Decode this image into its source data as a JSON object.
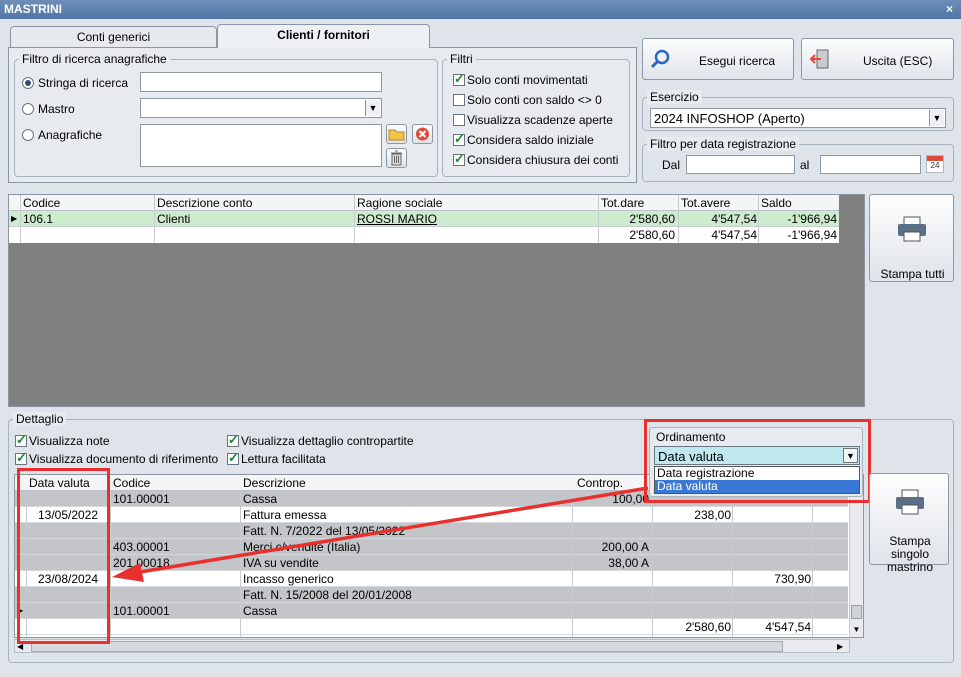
{
  "window": {
    "title": "MASTRINI",
    "close_glyph": "×"
  },
  "tabs": [
    {
      "label": "Conti generici"
    },
    {
      "label": "Clienti / fornitori"
    }
  ],
  "search_filter": {
    "legend": "Filtro di ricerca anagrafiche",
    "options": [
      {
        "label": "Stringa di ricerca",
        "selected": true
      },
      {
        "label": "Mastro",
        "selected": false
      },
      {
        "label": "Anagrafiche",
        "selected": false
      }
    ]
  },
  "filters": {
    "legend": "Filtri",
    "items": [
      {
        "label": "Solo conti movimentati",
        "checked": true
      },
      {
        "label": "Solo conti con saldo <> 0",
        "checked": false
      },
      {
        "label": "Visualizza scadenze aperte",
        "checked": false
      },
      {
        "label": "Considera saldo iniziale",
        "checked": true
      },
      {
        "label": "Considera chiusura dei conti",
        "checked": true
      }
    ]
  },
  "toolbar": {
    "search_label": "Esegui ricerca",
    "exit_label": "Uscita (ESC)",
    "print_all_label": "Stampa tutti",
    "print_single_label": "Stampa singolo mastrino"
  },
  "exercise": {
    "legend": "Esercizio",
    "value": "2024 INFOSHOP (Aperto)"
  },
  "date_filter": {
    "legend": "Filtro per data registrazione",
    "from_label": "Dal",
    "to_label": "al",
    "calendar_day": "24"
  },
  "accounts_table": {
    "columns": [
      "Codice",
      "Descrizione conto",
      "Ragione sociale",
      "Tot.dare",
      "Tot.avere",
      "Saldo"
    ],
    "rows": [
      {
        "codice": "106.1",
        "descrizione": "Clienti",
        "ragione": "ROSSI MARIO",
        "dare": "2'580,60",
        "avere": "4'547,54",
        "saldo": "-1'966,94"
      },
      {
        "codice": "",
        "descrizione": "",
        "ragione": "",
        "dare": "2'580,60",
        "avere": "4'547,54",
        "saldo": "-1'966,94"
      }
    ]
  },
  "detail": {
    "legend": "Dettaglio",
    "options": [
      {
        "label": "Visualizza note",
        "checked": true
      },
      {
        "label": "Visualizza documento di riferimento",
        "checked": true
      },
      {
        "label": "Visualizza dettaglio contropartite",
        "checked": true
      },
      {
        "label": "Lettura facilitata",
        "checked": true
      }
    ],
    "ordering": {
      "legend": "Ordinamento",
      "value": "Data valuta",
      "options": [
        "Data registrazione",
        "Data valuta"
      ]
    },
    "columns": [
      "Data valuta",
      "Codice",
      "Descrizione",
      "Controp."
    ],
    "rows": [
      {
        "data": "",
        "codice": "101.00001",
        "desc": "Cassa",
        "controp": "100,00",
        "dare": "",
        "avere": ""
      },
      {
        "data": "13/05/2022",
        "codice": "",
        "desc": "Fattura emessa",
        "controp": "",
        "dare": "238,00",
        "avere": ""
      },
      {
        "data": "",
        "codice": "",
        "desc": "Fatt. N. 7/2022 del 13/05/2022",
        "controp": "",
        "dare": "",
        "avere": ""
      },
      {
        "data": "",
        "codice": "403.00001",
        "desc": "Merci c/vendite (Italia)",
        "controp": "200,00 A",
        "dare": "",
        "avere": ""
      },
      {
        "data": "",
        "codice": "201.00018",
        "desc": "IVA su vendite",
        "controp": "38,00 A",
        "dare": "",
        "avere": ""
      },
      {
        "data": "23/08/2024",
        "codice": "",
        "desc": "Incasso generico",
        "controp": "",
        "dare": "",
        "avere": "730,90"
      },
      {
        "data": "",
        "codice": "",
        "desc": "Fatt. N. 15/2008 del 20/01/2008",
        "controp": "",
        "dare": "",
        "avere": ""
      },
      {
        "data": "",
        "codice": "101.00001",
        "desc": "Cassa",
        "controp": "",
        "dare": "",
        "avere": ""
      },
      {
        "data": "",
        "codice": "",
        "desc": "",
        "controp": "",
        "dare": "2'580,60",
        "avere": "4'547,54"
      }
    ]
  },
  "colors": {
    "selected_row": "#cdeccd",
    "dark_area": "#808080",
    "highlight": "#e8312f",
    "dropdown_selection": "#3a78d6"
  }
}
